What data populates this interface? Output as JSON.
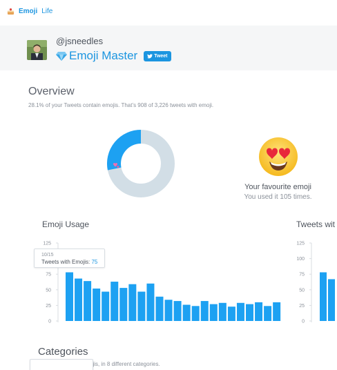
{
  "app": {
    "brand_primary": "Emoji",
    "brand_secondary": "Life",
    "brand_logo_icon": "cake-icon"
  },
  "profile": {
    "handle": "@jsneedles",
    "rank_icon": "gem-icon",
    "rank_title": "Emoji Master",
    "tweet_button_label": "Tweet",
    "tweet_button_icon": "bird-icon"
  },
  "overview": {
    "title": "Overview",
    "subtitle": "28.1% of your Tweets contain emojis. That’s 908 of 3,226 tweets with emoji.",
    "emoji_share": 0.281,
    "donut_emoji_icon": "two-hearts-icon"
  },
  "favourite": {
    "emoji_icon": "heart-eyes-face-icon",
    "title": "Your favourite emoji",
    "subtitle": "You used it 105 times."
  },
  "emoji_usage": {
    "title": "Emoji Usage",
    "tooltip_date": "10/15",
    "tooltip_label": "Tweets with Emojis: ",
    "tooltip_value": "75"
  },
  "tweets_panel": {
    "title": "Tweets wit"
  },
  "categories": {
    "title": "Categories",
    "subtitle_visible": "ojis, in 8 different categories."
  },
  "colors": {
    "accent": "#1b95e0",
    "bar": "#1da1f2",
    "donut_track": "#d2dee6"
  },
  "chart_data": [
    {
      "type": "bar",
      "title": "Emoji Usage",
      "ylim": [
        0,
        125
      ],
      "yticks": [
        0,
        25,
        50,
        75,
        100,
        125
      ],
      "values": [
        78,
        68,
        64,
        52,
        47,
        63,
        53,
        59,
        47,
        60,
        39,
        34,
        32,
        26,
        24,
        32,
        27,
        29,
        23,
        29,
        27,
        30,
        24,
        30
      ],
      "grid": false
    },
    {
      "type": "bar",
      "title": "Tweets wit",
      "ylim": [
        0,
        125
      ],
      "yticks": [
        0,
        25,
        50,
        75,
        100,
        125
      ],
      "values": [
        78,
        67
      ],
      "grid": false
    }
  ]
}
